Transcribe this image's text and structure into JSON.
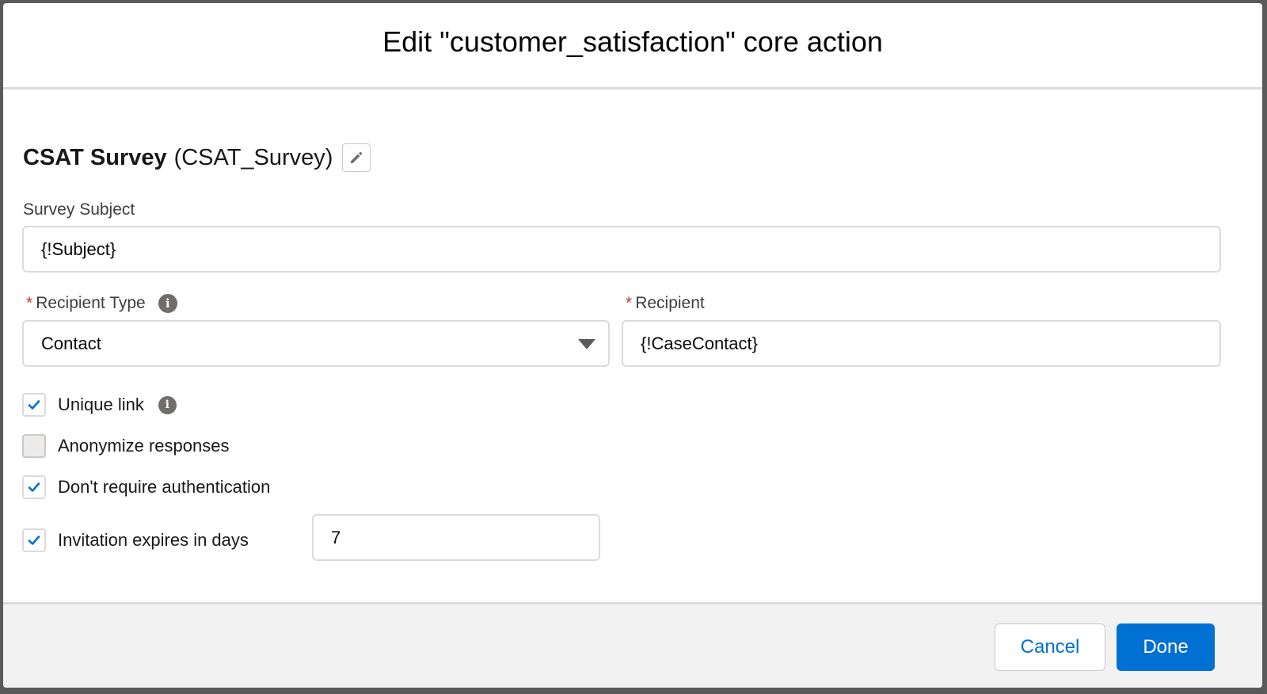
{
  "modal": {
    "title": "Edit \"customer_satisfaction\" core action"
  },
  "action": {
    "name": "CSAT Survey",
    "api_name": "(CSAT_Survey)",
    "edit_icon": "pencil-icon"
  },
  "fields": {
    "survey_subject": {
      "label": "Survey Subject",
      "value": "{!Subject}"
    },
    "recipient_type": {
      "required_marker": "*",
      "label": "Recipient Type",
      "selected": "Contact",
      "info_icon": "info-icon"
    },
    "recipient": {
      "required_marker": "*",
      "label": "Recipient",
      "value": "{!CaseContact}"
    }
  },
  "options": {
    "unique_link": {
      "label": "Unique link",
      "checked": true
    },
    "anonymize": {
      "label": "Anonymize responses",
      "checked": false
    },
    "no_auth": {
      "label": "Don't require authentication",
      "checked": true
    },
    "expires": {
      "label": "Invitation expires in days",
      "checked": true,
      "value": "7"
    }
  },
  "footer": {
    "cancel_label": "Cancel",
    "done_label": "Done"
  },
  "colors": {
    "brand": "#0070d2",
    "required": "#c23934",
    "footer_bg": "#f3f2f2",
    "border": "#dddbda"
  }
}
